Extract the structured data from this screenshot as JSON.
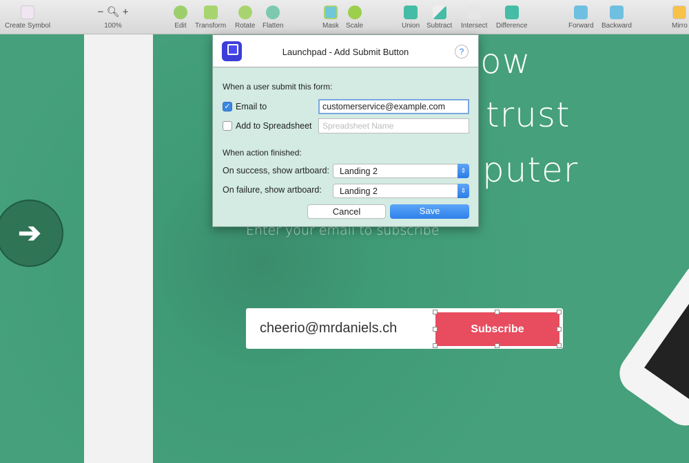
{
  "toolbar": {
    "items": [
      {
        "label": "Create Symbol",
        "icon": "create-symbol-icon"
      },
      {
        "label": "100%",
        "icon": "zoom-icon",
        "minus": "−",
        "plus": "+"
      },
      {
        "label": "Edit",
        "icon": "edit-icon"
      },
      {
        "label": "Transform",
        "icon": "transform-icon"
      },
      {
        "label": "Rotate",
        "icon": "rotate-icon"
      },
      {
        "label": "Flatten",
        "icon": "flatten-icon"
      },
      {
        "label": "Mask",
        "icon": "mask-icon"
      },
      {
        "label": "Scale",
        "icon": "scale-icon"
      },
      {
        "label": "Union",
        "icon": "union-icon"
      },
      {
        "label": "Subtract",
        "icon": "subtract-icon"
      },
      {
        "label": "Intersect",
        "icon": "intersect-icon"
      },
      {
        "label": "Difference",
        "icon": "difference-icon"
      },
      {
        "label": "Forward",
        "icon": "forward-icon"
      },
      {
        "label": "Backward",
        "icon": "backward-icon"
      },
      {
        "label": "Mirro",
        "icon": "mirror-icon"
      }
    ]
  },
  "canvas": {
    "headline": [
      "ow",
      "trust",
      "puter"
    ],
    "subtitle": "Enter your email to subscribe",
    "email_value": "cheerio@mrdaniels.ch",
    "subscribe_label": "Subscribe",
    "arrow": "➔",
    "accent": "#e84c5f",
    "background": "#3f9a76"
  },
  "dialog": {
    "title": "Launchpad - Add Submit Button",
    "help": "?",
    "section1": "When a user submit this form:",
    "email_to_label": "Email to",
    "email_to_checked": true,
    "email_value": "customerservice@example.com",
    "spreadsheet_label": "Add to Spreadsheet",
    "spreadsheet_checked": false,
    "spreadsheet_placeholder": "Spreadsheet Name",
    "section2": "When action finished:",
    "success_label": "On success, show artboard:",
    "success_value": "Landing 2",
    "failure_label": "On failure, show artboard:",
    "failure_value": "Landing 2",
    "cancel": "Cancel",
    "save": "Save"
  }
}
